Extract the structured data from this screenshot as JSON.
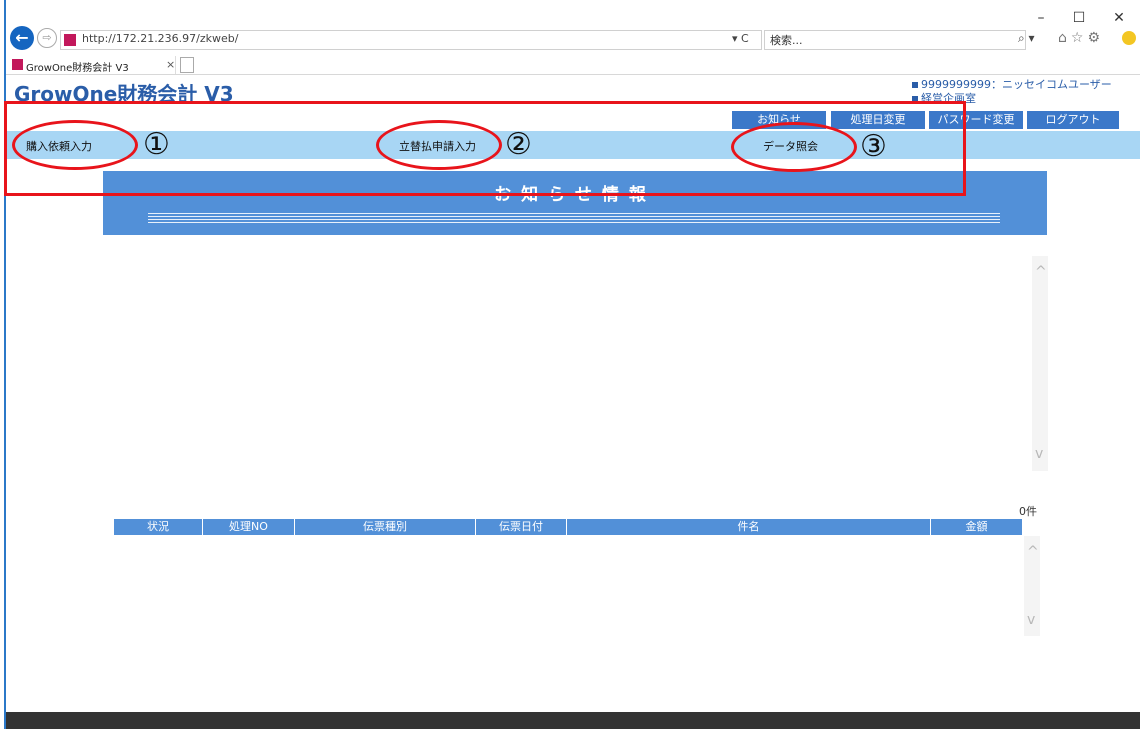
{
  "browser": {
    "url": "http://172.21.236.97/zkweb/",
    "address_dropdown": "▾ C",
    "search_placeholder": "検索...",
    "search_icon_glyph": "⌕ ▾",
    "tab_title": "GrowOne財務会計 V3",
    "tab_close": "×",
    "window_controls": [
      "–",
      "☐",
      "✕"
    ],
    "toolbar_icons": [
      "home-icon",
      "favorites-icon",
      "settings-icon",
      "smiley-icon"
    ],
    "toolbar_glyphs": "⌂☆⚙"
  },
  "app": {
    "title": "GrowOne財務会計 V3",
    "user_line1": "9999999999：ニッセイコムユーザー",
    "user_line2": "経営企画室"
  },
  "top_buttons": {
    "notice": "お知らせ",
    "process_date": "処理日変更",
    "password": "パスワード変更",
    "logout": "ログアウト"
  },
  "nav": {
    "purchase_request": "購入依頼入力",
    "advance_payment": "立替払申請入力",
    "data_inquiry": "データ照会"
  },
  "notice_panel": {
    "title": "お知らせ情報"
  },
  "scroll": {
    "up": "^",
    "down": "v"
  },
  "grid": {
    "count": "0件",
    "columns": [
      "状況",
      "処理NO",
      "伝票種別",
      "伝票日付",
      "件名",
      "金額"
    ]
  },
  "annotations": {
    "labels": [
      "①",
      "②",
      "③"
    ],
    "color": "#e8141b"
  }
}
